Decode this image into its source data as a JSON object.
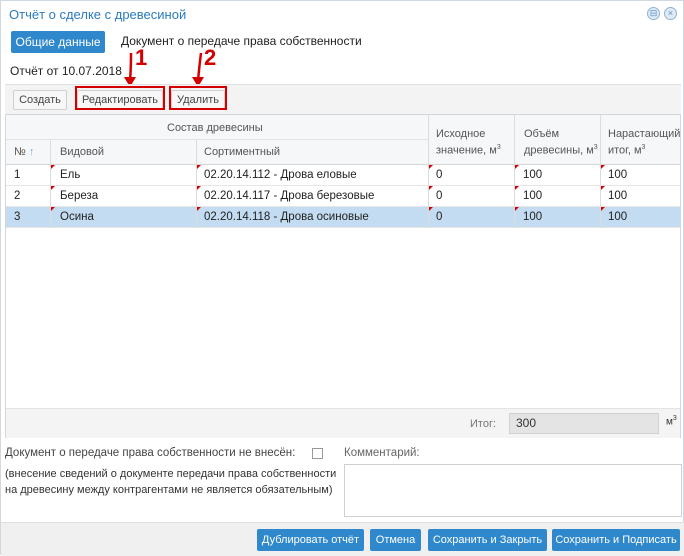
{
  "window": {
    "title": "Отчёт о сделке с древесиной",
    "minimize_glyph": "⊟",
    "close_glyph": "×"
  },
  "tabs": {
    "active": "Общие данные",
    "inactive": "Документ о передаче права собственности"
  },
  "report_date": "Отчёт от 10.07.2018",
  "annotations": [
    "1",
    "2"
  ],
  "toolbar": {
    "create": "Создать",
    "edit": "Редактировать",
    "delete": "Удалить"
  },
  "grid": {
    "group_header": "Состав древесины",
    "columns": {
      "num": "№",
      "species": "Видовой",
      "assortment": "Сортиментный",
      "initial": "Исходное значение, м",
      "volume": "Объём древесины, м",
      "cumulative": "Нарастающий итог, м",
      "sup": "3"
    },
    "sort_glyph": "↑",
    "rows": [
      {
        "num": "1",
        "species": "Ель",
        "assortment": "02.20.14.112 - Дрова еловые",
        "initial": "0",
        "volume": "100",
        "cumulative": "100"
      },
      {
        "num": "2",
        "species": "Береза",
        "assortment": "02.20.14.117 - Дрова березовые",
        "initial": "0",
        "volume": "100",
        "cumulative": "100"
      },
      {
        "num": "3",
        "species": "Осина",
        "assortment": "02.20.14.118 - Дрова осиновые",
        "initial": "0",
        "volume": "100",
        "cumulative": "100"
      }
    ],
    "selected_row": 3,
    "total_label": "Итог:",
    "total_value": "300",
    "total_unit": "м",
    "total_sup": "3"
  },
  "form": {
    "doc_not_entered": "Документ о передаче права собственности не внесён:",
    "comment_label": "Комментарий:",
    "note_line1": "(внесение сведений о документе передачи права собственности",
    "note_line2": "на древесину между контрагентами не является обязательным)"
  },
  "buttons": {
    "duplicate": "Дублировать отчёт",
    "cancel": "Отмена",
    "save_close": "Сохранить и Закрыть",
    "save_sign": "Сохранить и Подписать"
  },
  "colors": {
    "accent": "#2f88cc",
    "annotation_red": "#d40000",
    "selected_row": "#c3dcf1"
  }
}
